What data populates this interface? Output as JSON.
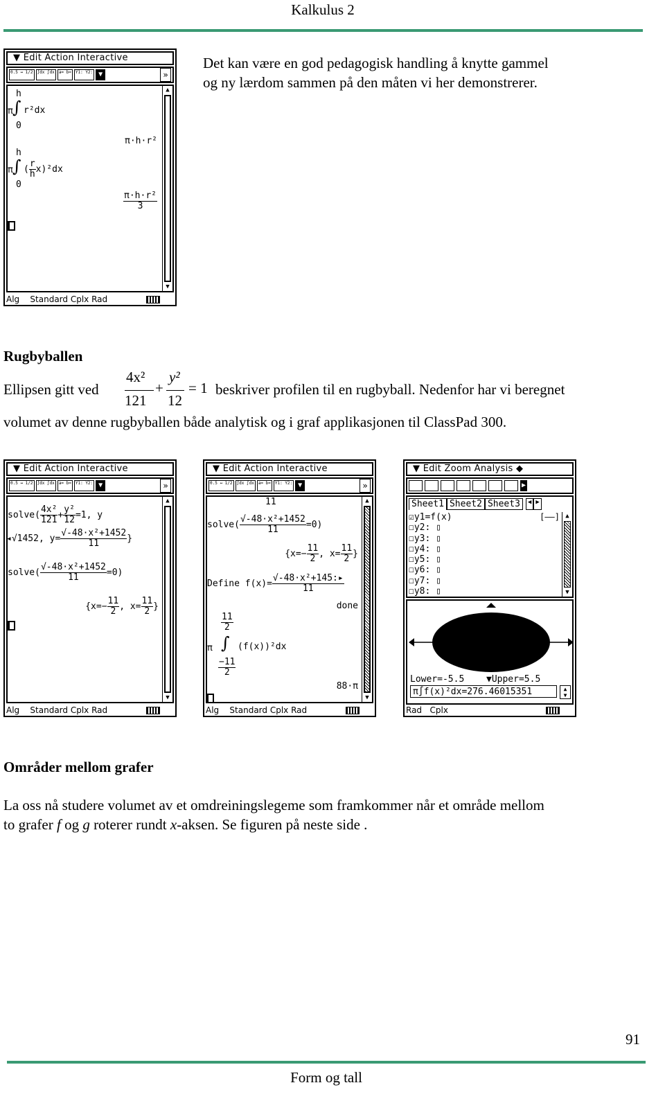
{
  "header": {
    "title": "Kalkulus 2"
  },
  "intro": {
    "lines": [
      "Det kan være en god pedagogisk handling å knytte gammel",
      "og ny lærdom sammen på den måten vi her demonstrerer."
    ]
  },
  "calc_common": {
    "menu_cas": "Edit Action Interactive",
    "menu_graph": "Edit Zoom Analysis ◆",
    "status_cas": "Alg    Standard Cplx Rad",
    "status_graph": "Rad   Cplx",
    "toolbar_cas": [
      "0.5 ↔ 1/2",
      "∫dx ∫dx",
      "a= b=",
      "Y1: Y2:",
      "▼"
    ],
    "toolbar_more": "»"
  },
  "calc1": {
    "int1_upper": "h",
    "int1_pi": "π",
    "int1_sign": "∫",
    "int1_body": "r²dx",
    "int1_lower": "0",
    "res1": "π·h·r²",
    "int2_upper": "h",
    "int2_pi": "π",
    "int2_sign": "∫",
    "int2_open": "(",
    "int2_num": "r",
    "int2_den": "h",
    "int2_body": "x)²dx",
    "int2_lower": "0",
    "res2_num": "π·h·r²",
    "res2_den": "3"
  },
  "section1": {
    "heading": "Rugbyballen",
    "eq_prefix": "Ellipsen gitt ved",
    "eq": {
      "n1": "4x²",
      "d1": "121",
      "plus": "+",
      "n2": "y²",
      "d2": "12",
      "rhs": "= 1"
    },
    "eq_suffix": "beskriver profilen til en rugbyball. Nedenfor har vi beregnet",
    "line2": "volumet av denne  rugbyballen både analytisk og i graf applikasjonen til ClassPad 300."
  },
  "calc2": {
    "solve1": "solve(",
    "f1n": "4x²",
    "f1d": "121",
    "plus": "+",
    "f2n": "y²",
    "f2d": "12",
    "tail1": "=1, y",
    "r1a": "◂√1452",
    "r1b": ", y=",
    "r1n": "√-48·x²+1452",
    "r1d": "11",
    "r1c": "}",
    "solve2": "solve(",
    "s2n": "√-48·x²+1452",
    "s2d": "11",
    "s2t": "=0)",
    "r2a": "{x=−",
    "r2n1": "11",
    "r2d1": "2",
    "r2b": ", x=",
    "r2n2": "11",
    "r2d2": "2",
    "r2c": "}"
  },
  "calc3": {
    "top": "11",
    "solve": "solve(",
    "sn": "√-48·x²+1452",
    "sd": "11",
    "st": "=0)",
    "ra": "{x=−",
    "rn1": "11",
    "rd1": "2",
    "rb": ", x=",
    "rn2": "11",
    "rd2": "2",
    "rc": "}",
    "define": "Define  f(x)=",
    "dn": "√-48·x²+145:▸",
    "dd": "11",
    "done": "done",
    "up_n": "11",
    "up_d": "2",
    "pi": "π",
    "sign": "∫",
    "body": "(f(x))²dx",
    "lo_n": "−11",
    "lo_d": "2",
    "result": "88·π"
  },
  "calc4": {
    "tabs": [
      "Sheet1",
      "Sheet2",
      "Sheet3"
    ],
    "functions": [
      "☑y1=f(x)",
      "☐y2: ▯",
      "☐y3: ▯",
      "☐y4: ▯",
      "☐y5: ▯",
      "☐y6: ▯",
      "☐y7: ▯",
      "☐y8: ▯"
    ],
    "line_style": "[——]",
    "lower": "Lower=-5.5",
    "upper": "▼Upper=5.5",
    "result": "π∫f(x)²dx=276.46015351"
  },
  "section2": {
    "heading": "Områder mellom grafer",
    "line1": "La oss nå studere volumet av et omdreiningslegeme som framkommer når et område mellom",
    "line2_parts": [
      "to grafer ",
      "f",
      " og ",
      "g",
      " roterer rundt ",
      "x",
      "-aksen. Se figuren på neste side ."
    ]
  },
  "footer": {
    "page_number": "91",
    "title": "Form og tall"
  },
  "colors": {
    "rule": "#3a9a73"
  }
}
